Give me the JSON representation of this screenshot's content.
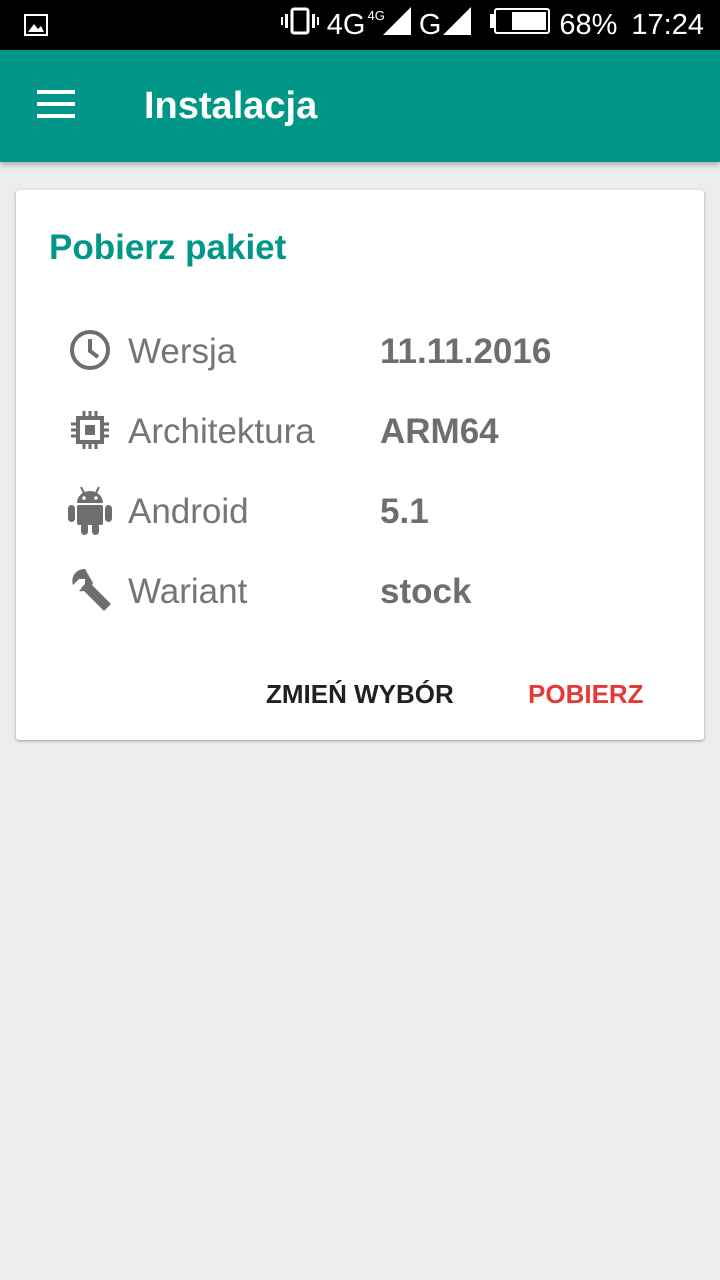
{
  "status_bar": {
    "network1": "4G",
    "network1_sub": "4G",
    "network2": "G",
    "battery": "68%",
    "time": "17:24"
  },
  "app_bar": {
    "title": "Instalacja"
  },
  "card": {
    "title": "Pobierz pakiet",
    "rows": [
      {
        "icon": "clock-icon",
        "label": "Wersja",
        "value": "11.11.2016"
      },
      {
        "icon": "cpu-chip-icon",
        "label": "Architektura",
        "value": "ARM64"
      },
      {
        "icon": "android-icon",
        "label": "Android",
        "value": "5.1"
      },
      {
        "icon": "wrench-icon",
        "label": "Wariant",
        "value": "stock"
      }
    ],
    "actions": {
      "change_label": "ZMIEŃ WYBÓR",
      "download_label": "POBIERZ"
    }
  },
  "colors": {
    "primary": "#009688",
    "accent": "#e53935",
    "background": "#ededed"
  }
}
